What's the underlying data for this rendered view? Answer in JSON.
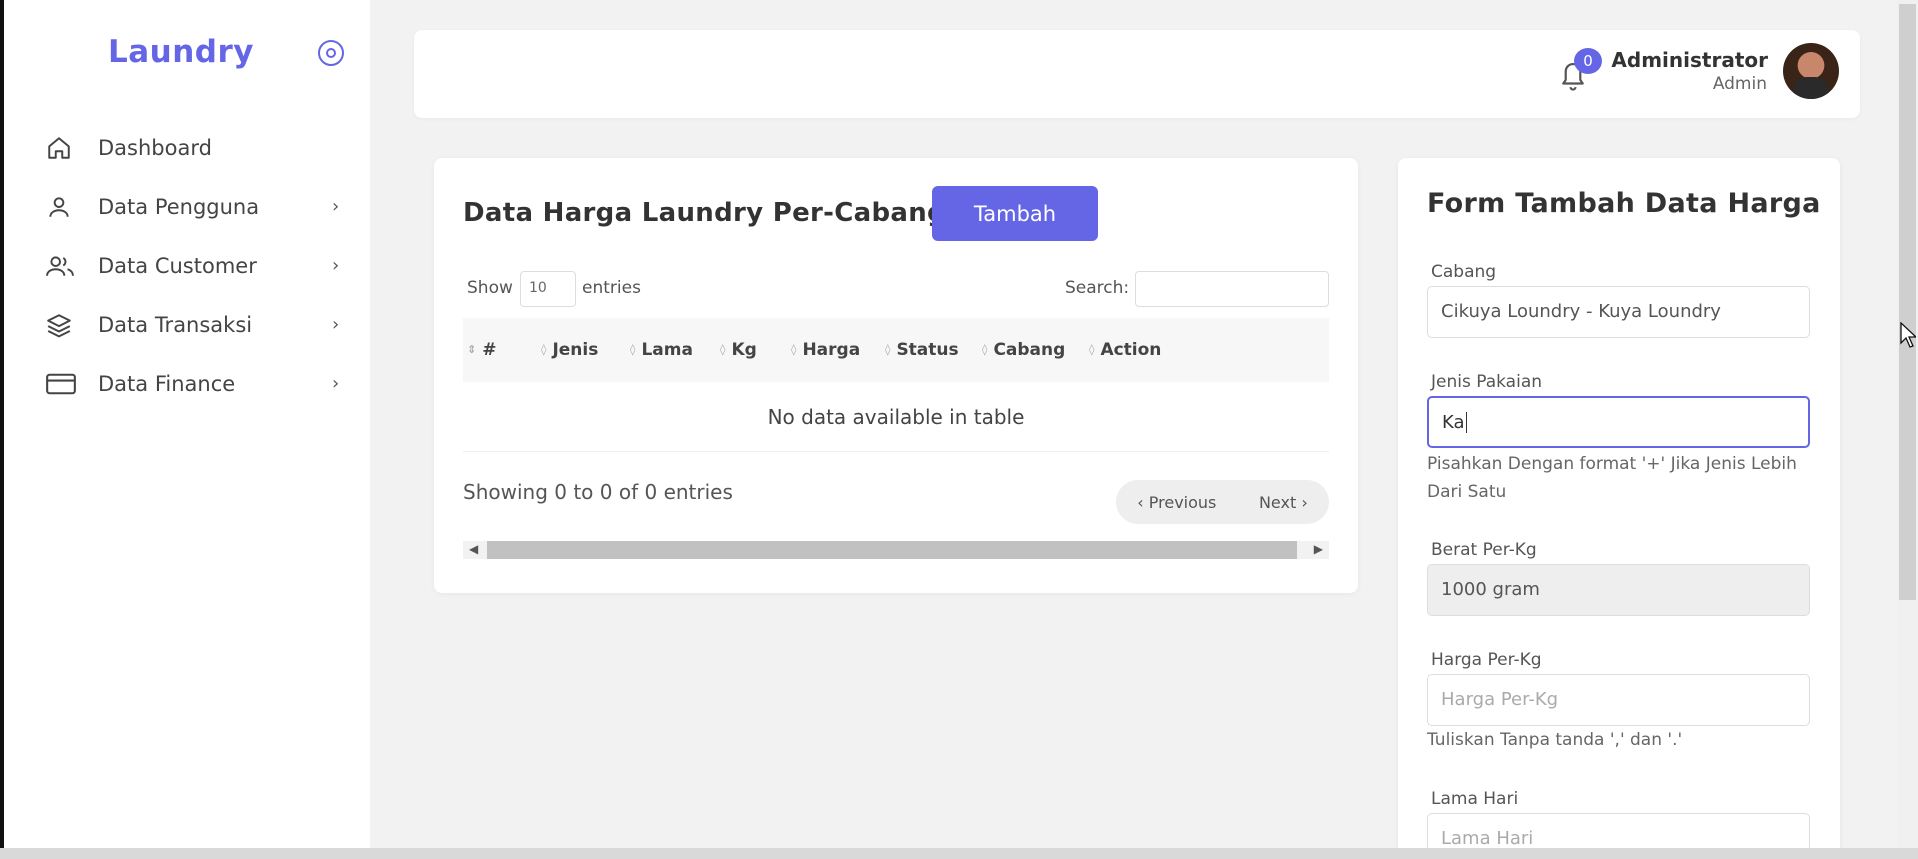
{
  "brand": {
    "name": "Laundry",
    "accent": "#6566e6"
  },
  "sidebar": {
    "items": [
      {
        "label": "Dashboard",
        "icon": "home-icon",
        "has_children": false
      },
      {
        "label": "Data Pengguna",
        "icon": "user-icon",
        "has_children": true
      },
      {
        "label": "Data Customer",
        "icon": "users-icon",
        "has_children": true
      },
      {
        "label": "Data Transaksi",
        "icon": "layers-icon",
        "has_children": true
      },
      {
        "label": "Data Finance",
        "icon": "credit-card-icon",
        "has_children": true
      }
    ]
  },
  "header": {
    "notification_count": "0",
    "user_name": "Administrator",
    "user_role": "Admin"
  },
  "table_card": {
    "title": "Data Harga Laundry Per-Cabang",
    "add_label": "Tambah",
    "show_label": "Show",
    "show_value": "10",
    "entries_label": "entries",
    "search_label": "Search:",
    "columns": [
      "#",
      "Jenis",
      "Lama",
      "Kg",
      "Harga",
      "Status",
      "Cabang",
      "Action"
    ],
    "empty_text": "No data available in table",
    "info_text": "Showing 0 to 0 of 0 entries",
    "prev_label": "‹ Previous",
    "next_label": "Next ›"
  },
  "form_card": {
    "title": "Form Tambah Data Harga",
    "cabang": {
      "label": "Cabang",
      "value": "Cikuya Loundry - Kuya Loundry"
    },
    "jenis": {
      "label": "Jenis Pakaian",
      "value": "Ka",
      "help": "Pisahkan Dengan format '+' Jika Jenis Lebih Dari Satu"
    },
    "berat": {
      "label": "Berat Per-Kg",
      "value": "1000 gram"
    },
    "harga": {
      "label": "Harga Per-Kg",
      "placeholder": "Harga Per-Kg",
      "help": "Tuliskan Tanpa tanda ',' dan '.'"
    },
    "lama": {
      "label": "Lama Hari",
      "placeholder": "Lama Hari"
    }
  }
}
